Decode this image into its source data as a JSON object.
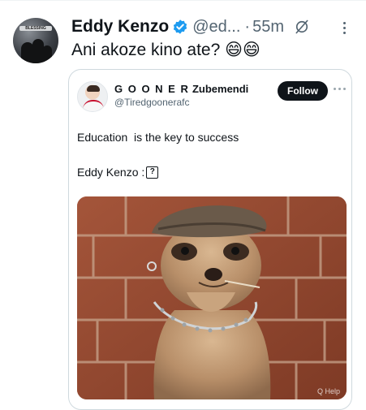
{
  "tweet": {
    "author_name": "Eddy Kenzo",
    "handle": "@ed...",
    "separator": "·",
    "timestamp": "55m",
    "text": "Ani akoze kino ate? 😄😄",
    "avatar_caption": "BLESSING"
  },
  "quoted": {
    "name_spaced": "G O O N E R",
    "name_rest": " Zubemendi",
    "handle": "@Tiredgoonerafc",
    "follow_label": "Follow",
    "line1": "Education  is the key to success",
    "line2": "Eddy Kenzo :",
    "line2_glyph": "?",
    "image_alt": "Meerkat wearing a flat cap and a chain necklace",
    "watermark": "Q Help"
  },
  "icons": {
    "verified": "verified-badge-icon",
    "grok": "grok-icon",
    "more": "more-options-icon"
  },
  "colors": {
    "verified": "#1d9bf0",
    "follow_bg": "#0f1419",
    "secondary_text": "#536471",
    "card_border": "#cfd9de"
  }
}
